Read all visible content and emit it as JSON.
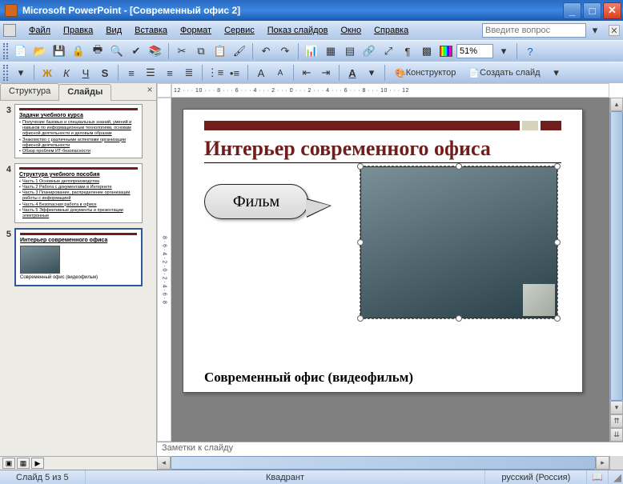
{
  "title": "Microsoft PowerPoint - [Современный офис 2]",
  "menu": {
    "file": "Файл",
    "edit": "Правка",
    "view": "Вид",
    "insert": "Вставка",
    "format": "Формат",
    "service": "Сервис",
    "slideshow": "Показ слайдов",
    "window": "Окно",
    "help": "Справка"
  },
  "search_placeholder": "Введите вопрос",
  "zoom": "51%",
  "toolbar2": {
    "designer": "Конструктор",
    "newslide": "Создать слайд"
  },
  "tabs": {
    "outline": "Структура",
    "slides": "Слайды"
  },
  "thumbnails": [
    {
      "num": "3",
      "title": "Задачи учебного курса",
      "items": [
        "Получение базовых и специальных знаний, умений и навыков по информационным технологиям, основам офисной деятельности и деловым образам",
        "Знакомство с различными аспектами организации офисной деятельности",
        "Обзор проблем ИТ-безопасности"
      ]
    },
    {
      "num": "4",
      "title": "Структура учебного пособия",
      "items": [
        "Часть 1 Основные делопроизводства",
        "Часть 2 Работа с документами в Интернете",
        "Часть 3 Планирование, распределение организации работы с информацией",
        "Часть 4 Безопасная работа в офисе",
        "Часть 5 Эффективные документы и презентации электронные"
      ]
    },
    {
      "num": "5",
      "title": "Интерьер современного офиса",
      "caption": "Современный офис (видеофильм)"
    }
  ],
  "ruler": "12 · · · 10 · · · 8 · · · 6 · · · 4 · · · 2 · · · 0 · · · 2 · · · 4 · · · 6 · · · 8 · · · 10 · · · 12",
  "rulerv": "8 · 6 · 4 · 2 · 0 · 2 · 4 · 6 · 8",
  "slide": {
    "title": "Интерьер современного офиса",
    "callout": "Фильм",
    "caption": "Современный офис (видеофильм)"
  },
  "notes_placeholder": "Заметки к слайду",
  "status": {
    "slide": "Слайд 5 из 5",
    "theme": "Квадрант",
    "lang": "русский (Россия)"
  }
}
